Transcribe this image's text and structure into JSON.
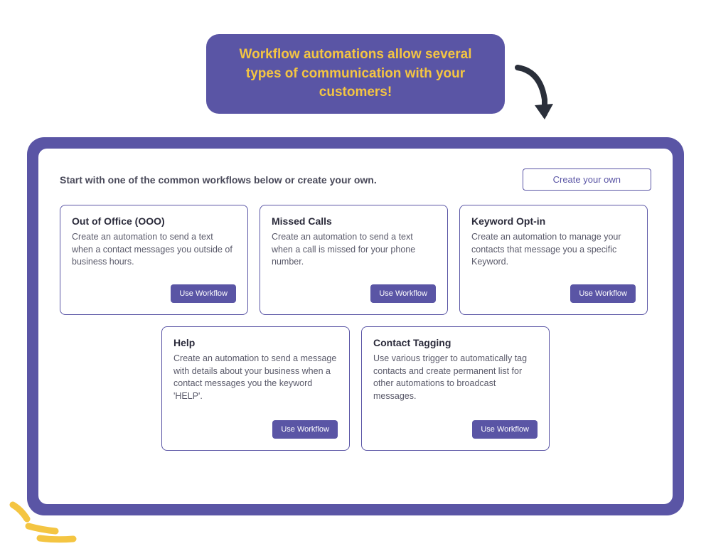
{
  "callout": "Workflow automations allow several types of communication with your customers!",
  "panel": {
    "instruction": "Start with one of the common workflows below or create your own.",
    "create_own_label": "Create your own"
  },
  "cards": {
    "row1": [
      {
        "title": "Out of Office (OOO)",
        "desc": "Create an automation to send a text when a contact messages you outside of business hours.",
        "button": "Use Workflow"
      },
      {
        "title": "Missed Calls",
        "desc": "Create an automation to send a text when a call is missed for your phone number.",
        "button": "Use Workflow"
      },
      {
        "title": "Keyword Opt-in",
        "desc": "Create an automation to manage your contacts that message you a specific Keyword.",
        "button": "Use Workflow"
      }
    ],
    "row2": [
      {
        "title": "Help",
        "desc": "Create an automation to send a message with details about your business when a contact messages you the keyword 'HELP'.",
        "button": "Use Workflow"
      },
      {
        "title": "Contact Tagging",
        "desc": "Use various trigger to automatically tag contacts and create permanent list for other automations to broadcast messages.",
        "button": "Use Workflow"
      }
    ]
  }
}
